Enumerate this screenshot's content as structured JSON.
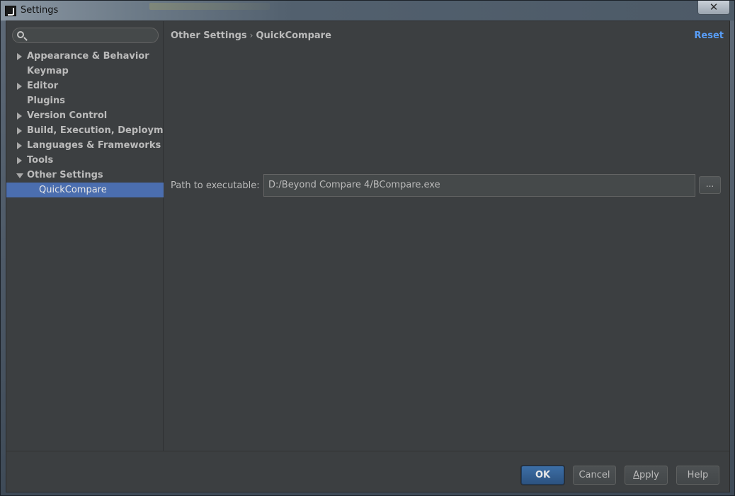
{
  "window": {
    "title": "Settings",
    "close_glyph": "✕",
    "app_icon": "intellij-icon"
  },
  "sidebar": {
    "search": {
      "placeholder": "",
      "value": "",
      "icon": "search-icon"
    },
    "items": [
      {
        "label": "Appearance & Behavior",
        "expandable": true,
        "expanded": false
      },
      {
        "label": "Keymap",
        "expandable": false
      },
      {
        "label": "Editor",
        "expandable": true,
        "expanded": false
      },
      {
        "label": "Plugins",
        "expandable": false
      },
      {
        "label": "Version Control",
        "expandable": true,
        "expanded": false
      },
      {
        "label": "Build, Execution, Deployment",
        "expandable": true,
        "expanded": false
      },
      {
        "label": "Languages & Frameworks",
        "expandable": true,
        "expanded": false
      },
      {
        "label": "Tools",
        "expandable": true,
        "expanded": false
      },
      {
        "label": "Other Settings",
        "expandable": true,
        "expanded": true
      },
      {
        "label": "QuickCompare",
        "child": true,
        "selected": true
      }
    ]
  },
  "content": {
    "breadcrumb": {
      "parent": "Other Settings",
      "separator": "›",
      "current": "QuickCompare"
    },
    "reset_label": "Reset",
    "path": {
      "label": "Path to executable:",
      "value": "D:/Beyond Compare 4/BCompare.exe",
      "browse_label": "..."
    }
  },
  "footer": {
    "ok_label": "OK",
    "cancel_label": "Cancel",
    "apply_label": "Apply",
    "help_label": "Help"
  },
  "colors": {
    "background": "#3c3f41",
    "selection": "#4b6eaf",
    "link": "#589df6",
    "text": "#bbbbbb"
  }
}
